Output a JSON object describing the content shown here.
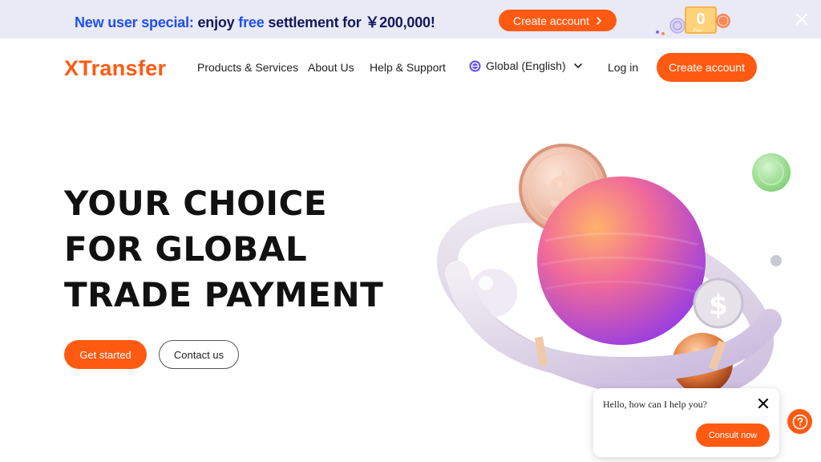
{
  "promo": {
    "part1": "New user special:",
    "part2": " enjoy ",
    "part3": "free",
    "part4": " settlement for ￥200,000!",
    "cta": "Create account",
    "badge_digit": "0",
    "badge_text": "Fee"
  },
  "header": {
    "logo": "XTransfer",
    "nav": [
      "Products & Services",
      "About Us",
      "Help & Support"
    ],
    "language": "Global (English)",
    "login": "Log in",
    "create_account": "Create account"
  },
  "hero": {
    "lines": [
      "YOUR CHOICE",
      "FOR GLOBAL",
      "TRADE PAYMENT"
    ],
    "primary_cta": "Get started",
    "secondary_cta": "Contact us"
  },
  "chat": {
    "message": "Hello, how can I help you?",
    "button": "Consult now"
  },
  "colors": {
    "brand": "#ff5a12",
    "promo_bg": "#e9eaf6",
    "promo_text": "#14185c",
    "promo_highlight": "#1f4ff0"
  },
  "icons": [
    "chevron-right-icon",
    "close-icon",
    "globe-icon",
    "chevron-down-icon",
    "help-icon",
    "dollar-coin-icon"
  ]
}
